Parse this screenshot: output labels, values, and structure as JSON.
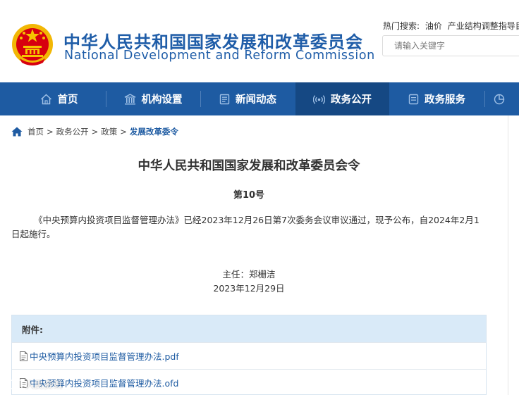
{
  "header": {
    "logo_cn": "中华人民共和国国家发展和改革委员会",
    "logo_en": "National Development and Reform Commission",
    "hot_search_label": "热门搜索:",
    "hot_search_terms": [
      "油价",
      "产业结构调整指导目录"
    ],
    "search_placeholder": "请输入关键字"
  },
  "nav": {
    "items": [
      {
        "label": "首页",
        "icon": "home-icon"
      },
      {
        "label": "机构设置",
        "icon": "institution-icon"
      },
      {
        "label": "新闻动态",
        "icon": "news-icon"
      },
      {
        "label": "政务公开",
        "icon": "broadcast-icon",
        "active": true
      },
      {
        "label": "政务服务",
        "icon": "service-icon"
      },
      {
        "label": "",
        "icon": "chart-icon"
      }
    ]
  },
  "breadcrumb": {
    "items": [
      "首页",
      "政务公开",
      "政策",
      "发展改革委令"
    ],
    "separator": ">"
  },
  "article": {
    "title": "中华人民共和国国家发展和改革委员会令",
    "number": "第10号",
    "body": "《中央预算内投资项目监督管理办法》已经2023年12月26日第7次委务会议审议通过，现予公布，自2024年2月1日起施行。",
    "signer": "主任：郑栅洁",
    "date": "2023年12月29日"
  },
  "attachments": {
    "heading": "附件:",
    "files": [
      {
        "name": "中央预算内投资项目监督管理办法.pdf",
        "icon": "document-icon"
      },
      {
        "name": "中央预算内投资项目监督管理办法.ofd",
        "icon": "document-icon"
      }
    ]
  },
  "watermark": {
    "text": "人民资讯"
  },
  "colors": {
    "brand_blue": "#1e5ba2",
    "nav_active": "#154883",
    "attach_header": "#d9eaf8",
    "emblem_red": "#d7000f",
    "emblem_gold": "#f5c400"
  }
}
